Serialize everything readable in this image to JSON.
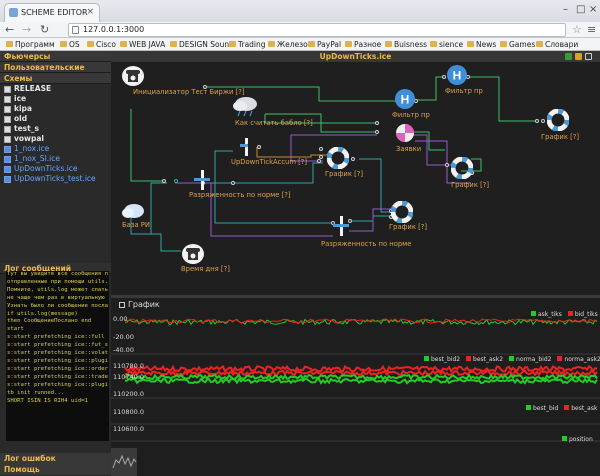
{
  "browser": {
    "tab_title": "SCHEME EDITOR",
    "url": "127.0.0.1:3000",
    "bookmarks": [
      "Программ",
      "OS",
      "Cisco",
      "WEB JAVA",
      "DESIGN Sound",
      "Trading",
      "Железо",
      "PayPal",
      "Разное",
      "Buisness",
      "sience",
      "News",
      "Games",
      "Словари"
    ]
  },
  "left": {
    "futures": "Фьючерсы",
    "user": "Пользовательские",
    "schemes": "Схемы",
    "tree": [
      {
        "label": "RELEASE",
        "kind": "dir"
      },
      {
        "label": "ice",
        "kind": "dir"
      },
      {
        "label": "kipa",
        "kind": "dir"
      },
      {
        "label": "old",
        "kind": "dir"
      },
      {
        "label": "test_s",
        "kind": "dir"
      },
      {
        "label": "vowpal",
        "kind": "dir"
      },
      {
        "label": "1_nox.ice",
        "kind": "file"
      },
      {
        "label": "1_nox_SI.ice",
        "kind": "file"
      },
      {
        "label": "UpDownTicks.ice",
        "kind": "file"
      },
      {
        "label": "UpDownTicks_test.ice",
        "kind": "file"
      }
    ],
    "log_title": "Лог сообщений",
    "log_lines": [
      "Тут вы увидите все сообщения п",
      "отправленные при помощи utils.",
      "Помните, utils.log может слать",
      "не чаще чем раз в виртуальную",
      "Узнать было ли сообщение посла",
      "if utils.log(message)",
      "then СообщениеПослано end",
      "start",
      "s:start prefetching ice::full",
      "s:start prefetching ice::fut_s",
      "s:start prefetching ice::volat",
      "s:start prefetching ice::plugi",
      "s:start prefetching ice::order",
      "s:start prefetching ice::trade",
      "s:start prefetching ice::plugi",
      "tb init runned...",
      "SHORT ISIN IS RIH4 uid=1"
    ],
    "errors_title": "Лог ошибок",
    "help_title": "Помощь"
  },
  "scheme": {
    "title": "UpDownTicks.ice",
    "nodes": {
      "init": "Инициализатор Тест Биржи [?]",
      "calc": "Как считать бабло [?]",
      "accum": "UpDownTickAccum [?]",
      "disch1": "Разряженность по норме [?]",
      "base": "База РИ",
      "time": "Время дня [?]",
      "disch2": "Разряженность по норме",
      "chart1": "График [?]",
      "chart2": "График [?]",
      "chart3": "График [?]",
      "chart4": "График [?]",
      "filter1": "Фильтр пр",
      "filter2": "Фильтр пр",
      "orders": "Заявки"
    }
  },
  "chart": {
    "title": "График",
    "panels": [
      {
        "legend": [
          "ask_tiks",
          "bid_tiks"
        ],
        "legend_colors": [
          "#22cc22",
          "#ee2222"
        ],
        "yticks": [
          "0.00",
          "-20.00",
          "-40.00"
        ]
      },
      {
        "legend": [
          "best_bid2",
          "best_ask2",
          "norma_bid2",
          "norma_ask2"
        ],
        "legend_colors": [
          "#22cc22",
          "#ee2222",
          "#22cc22",
          "#ee2222"
        ],
        "yticks": [
          "110780.0",
          "110740.0",
          "110200.0"
        ]
      },
      {
        "legend": [
          "best_bid",
          "best_ask"
        ],
        "legend_colors": [
          "#22cc22",
          "#ee2222"
        ],
        "yticks": [
          "110800.0",
          "110600.0"
        ]
      },
      {
        "legend": [
          "position"
        ],
        "legend_colors": [
          "#22cc22"
        ],
        "yticks": []
      }
    ]
  }
}
